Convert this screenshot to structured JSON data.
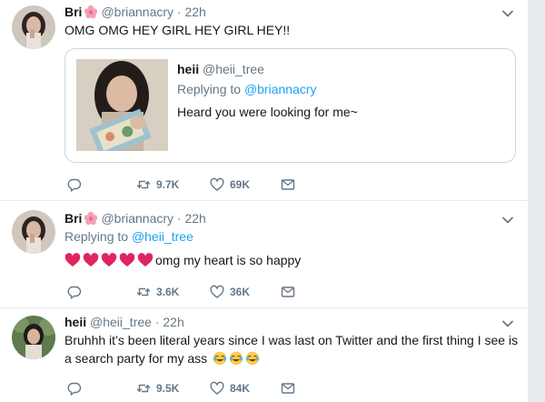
{
  "tweets": [
    {
      "name": "Bri",
      "handle": "@briannacry",
      "time": "22h",
      "text": "OMG OMG HEY GIRL HEY GIRL HEY!!",
      "quote": {
        "name": "heii",
        "handle": "@heii_tree",
        "reply_prefix": "Replying to",
        "reply_to": "@briannacry",
        "text": "Heard you were looking for me~"
      },
      "retweets": "9.7K",
      "likes": "69K"
    },
    {
      "name": "Bri",
      "handle": "@briannacry",
      "time": "22h",
      "reply_prefix": "Replying to",
      "reply_to": "@heii_tree",
      "text": "omg my heart is so happy",
      "retweets": "3.6K",
      "likes": "36K"
    },
    {
      "name": "heii",
      "handle": "@heii_tree",
      "time": "22h",
      "text": "Bruhhh it’s been literal years since I was last on Twitter and the first thing I see is a search party for my ass",
      "retweets": "9.5K",
      "likes": "84K"
    }
  ],
  "colors": {
    "accent": "#1da1f2",
    "muted": "#657786",
    "border": "#e6ecf0",
    "heart": "#e0245e"
  },
  "icons": [
    "reply-icon",
    "retweet-icon",
    "like-icon",
    "direct-message-icon",
    "caret-down-icon",
    "flower-emoji",
    "red-heart-emoji",
    "tears-of-joy-emoji"
  ]
}
